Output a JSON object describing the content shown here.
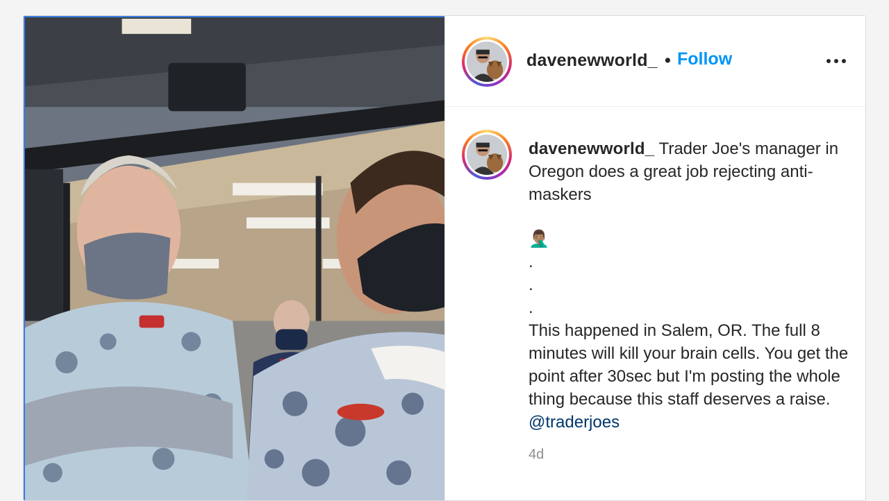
{
  "post": {
    "username": "davenewworld_",
    "separator": "•",
    "follow_label": "Follow",
    "more_icon": "more-options-icon",
    "caption_lead": "Trader Joe's manager in Oregon does a great job rejecting anti-maskers",
    "emoji": "🤦🏽‍♂️",
    "dots": [
      ".",
      ".",
      "."
    ],
    "caption_body": "This happened in Salem, OR. The full 8 minutes will kill your brain cells. You get the point after 30sec but I'm posting the whole thing because this staff deserves a raise.",
    "mention": "@traderjoes",
    "timestamp": "4d"
  },
  "colors": {
    "follow": "#0095f6",
    "mention": "#00376b",
    "text": "#262626",
    "muted": "#8e8e8e",
    "media_border": "#3b7be0"
  }
}
